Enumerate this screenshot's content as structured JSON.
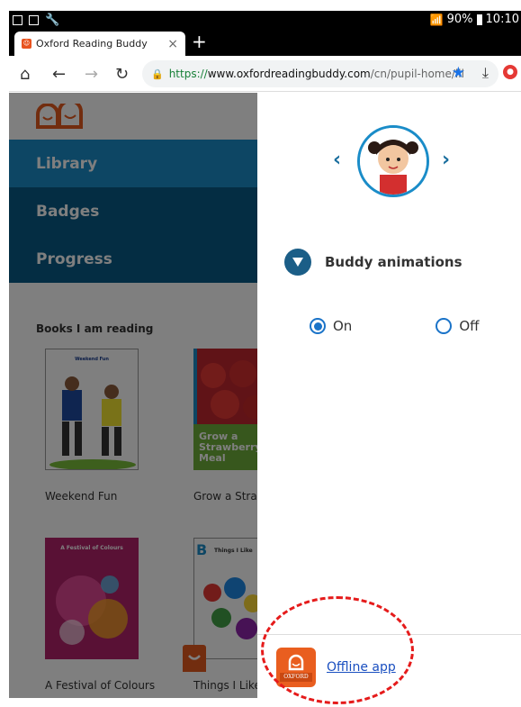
{
  "status_bar": {
    "battery": "90%",
    "time": "10:10"
  },
  "tab": {
    "title": "Oxford Reading Buddy"
  },
  "toolbar": {
    "url_scheme": "https://",
    "url_host": "www.oxfordreadingbuddy.com",
    "url_path": "/cn/pupil-home/lil"
  },
  "sidebar": {
    "nav": [
      "Library",
      "Badges",
      "Progress"
    ],
    "section_title": "Books I am reading",
    "books": [
      {
        "title": "Weekend Fun",
        "cover_title": "Weekend Fun"
      },
      {
        "title": "Grow a Straw",
        "cover_title": "Grow a Strawberry Meal"
      },
      {
        "title": "A Festival of Colours",
        "cover_title": "A Festival of Colours"
      },
      {
        "title": "Things I Like",
        "cover_title": "Things I Like"
      }
    ]
  },
  "panel": {
    "animations_label": "Buddy animations",
    "radio_on": "On",
    "radio_off": "Off",
    "selected": "On",
    "offline_label": "Offline app",
    "oxford_label": "OXFORD"
  },
  "colors": {
    "library": "#1a8cc8",
    "nav_dark": "#085b86",
    "accent": "#1b5e87",
    "oxford": "#e95e1f"
  }
}
